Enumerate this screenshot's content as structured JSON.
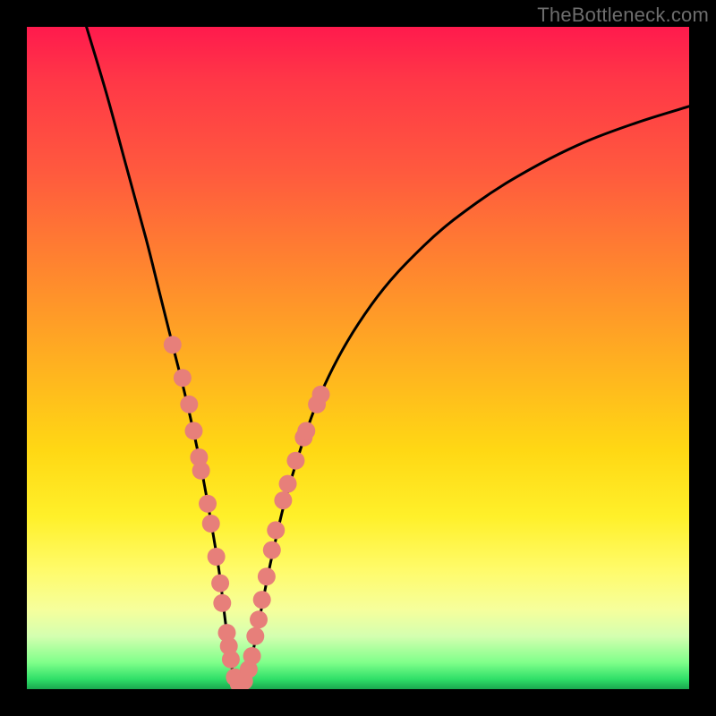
{
  "watermark": "TheBottleneck.com",
  "chart_data": {
    "type": "line",
    "title": "",
    "xlabel": "",
    "ylabel": "",
    "xlim": [
      0,
      100
    ],
    "ylim": [
      0,
      100
    ],
    "grid": false,
    "legend": false,
    "curve": {
      "name": "bottleneck-curve",
      "x": [
        9,
        12,
        15,
        18,
        20,
        22,
        24,
        26,
        27.5,
        29,
        30,
        31,
        32,
        33.5,
        35,
        37,
        40,
        45,
        52,
        60,
        68,
        76,
        84,
        92,
        100
      ],
      "y": [
        100,
        90,
        79,
        68,
        60,
        52,
        44,
        35,
        27,
        18,
        10,
        3,
        0.8,
        3,
        10,
        20,
        32,
        46,
        58,
        67,
        73.5,
        78.5,
        82.5,
        85.5,
        88
      ]
    },
    "dots": {
      "name": "highlighted-points",
      "color": "#e77f7a",
      "radius_pct": 1.35,
      "points": [
        {
          "x": 22.0,
          "y": 52.0
        },
        {
          "x": 23.5,
          "y": 47.0
        },
        {
          "x": 24.5,
          "y": 43.0
        },
        {
          "x": 25.2,
          "y": 39.0
        },
        {
          "x": 26.0,
          "y": 35.0
        },
        {
          "x": 26.3,
          "y": 33.0
        },
        {
          "x": 27.3,
          "y": 28.0
        },
        {
          "x": 27.8,
          "y": 25.0
        },
        {
          "x": 28.6,
          "y": 20.0
        },
        {
          "x": 29.2,
          "y": 16.0
        },
        {
          "x": 29.5,
          "y": 13.0
        },
        {
          "x": 30.2,
          "y": 8.5
        },
        {
          "x": 30.5,
          "y": 6.5
        },
        {
          "x": 30.8,
          "y": 4.5
        },
        {
          "x": 31.4,
          "y": 1.8
        },
        {
          "x": 32.0,
          "y": 0.8
        },
        {
          "x": 32.8,
          "y": 1.2
        },
        {
          "x": 33.5,
          "y": 3.0
        },
        {
          "x": 34.0,
          "y": 5.0
        },
        {
          "x": 34.5,
          "y": 8.0
        },
        {
          "x": 35.0,
          "y": 10.5
        },
        {
          "x": 35.5,
          "y": 13.5
        },
        {
          "x": 36.2,
          "y": 17.0
        },
        {
          "x": 37.0,
          "y": 21.0
        },
        {
          "x": 37.6,
          "y": 24.0
        },
        {
          "x": 38.7,
          "y": 28.5
        },
        {
          "x": 39.4,
          "y": 31.0
        },
        {
          "x": 40.6,
          "y": 34.5
        },
        {
          "x": 41.8,
          "y": 38.0
        },
        {
          "x": 42.2,
          "y": 39.0
        },
        {
          "x": 43.8,
          "y": 43.0
        },
        {
          "x": 44.4,
          "y": 44.5
        }
      ]
    }
  }
}
